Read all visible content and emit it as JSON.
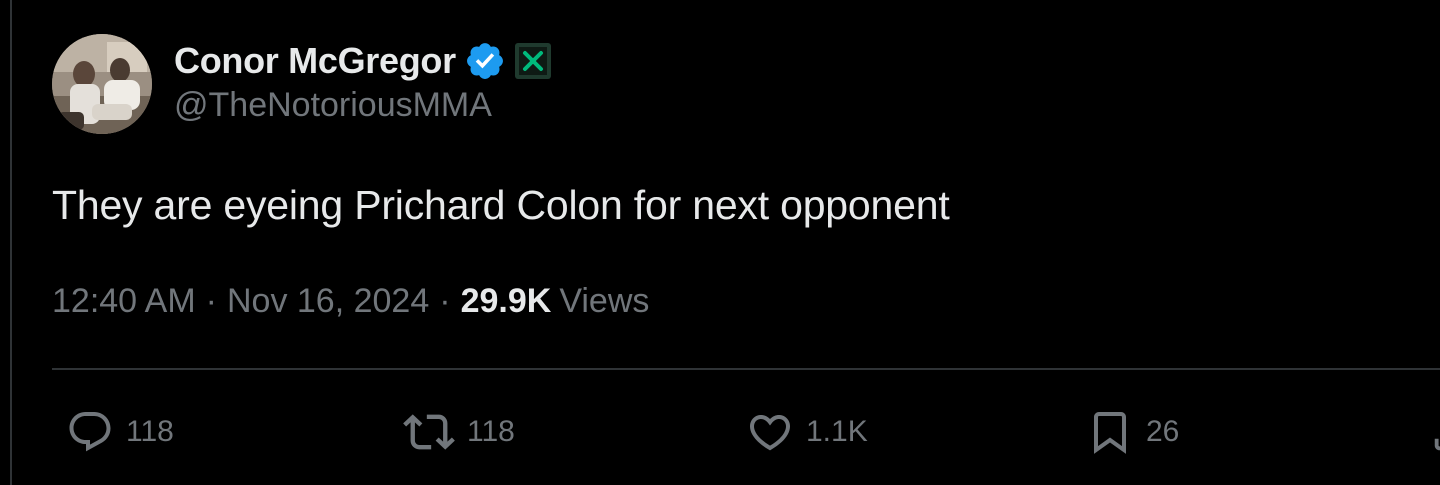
{
  "colors": {
    "background": "#000000",
    "text_primary": "#e7e9ea",
    "text_secondary": "#71767b",
    "divider": "#2f3336",
    "verified_blue": "#1d9bf0",
    "affiliate_green": "#00ba7c"
  },
  "author": {
    "display_name": "Conor McGregor",
    "handle": "@TheNotoriousMMA",
    "verified_icon": "verified-badge-icon",
    "affiliate_icon": "affiliate-badge-icon"
  },
  "tweet": {
    "text": "They are eyeing Prichard Colon for next opponent",
    "time": "12:40 AM",
    "separator": "·",
    "date": "Nov 16, 2024",
    "views_count": "29.9K",
    "views_label": "Views"
  },
  "actions": {
    "reply": {
      "icon": "reply-icon",
      "count": "118"
    },
    "retweet": {
      "icon": "retweet-icon",
      "count": "118"
    },
    "like": {
      "icon": "heart-icon",
      "count": "1.1K"
    },
    "bookmark": {
      "icon": "bookmark-icon",
      "count": "26"
    },
    "share": {
      "icon": "share-icon"
    }
  }
}
